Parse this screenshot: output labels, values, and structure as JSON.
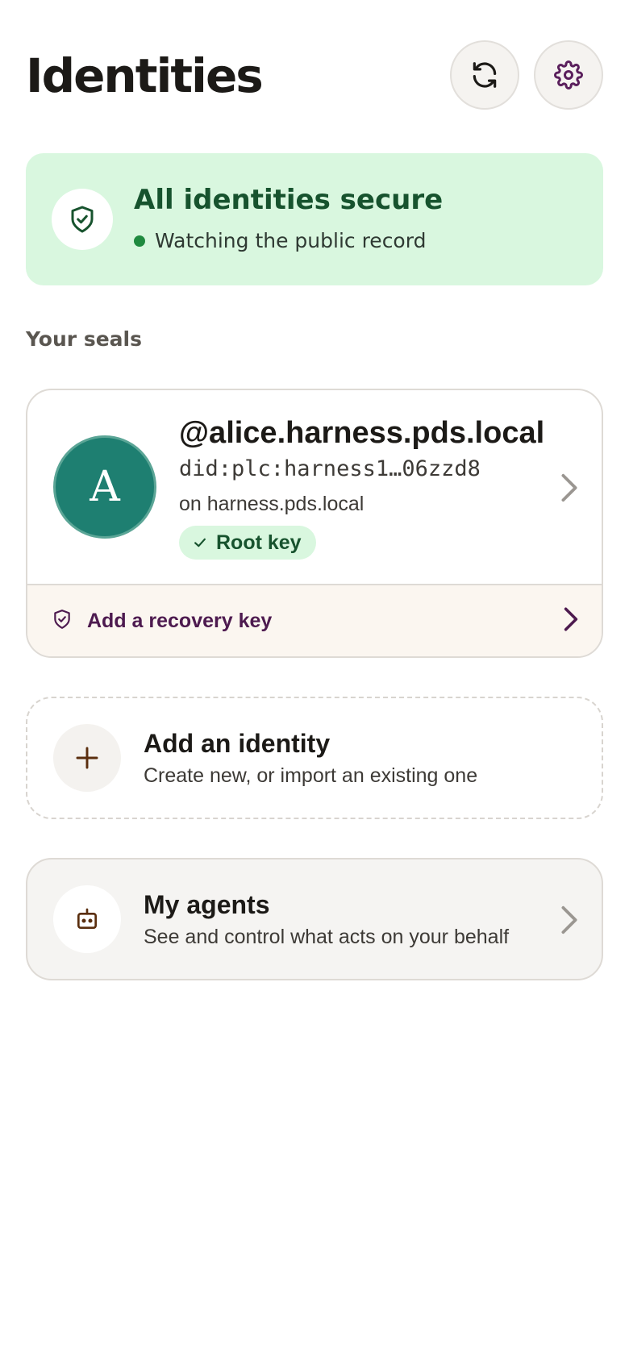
{
  "header": {
    "title": "Identities",
    "refresh_icon": "refresh-icon",
    "settings_icon": "gear-icon"
  },
  "status": {
    "title": "All identities secure",
    "subtitle": "Watching the public record",
    "icon": "shield-check-icon",
    "color": "#17532e",
    "background": "#d9f7df"
  },
  "seals": {
    "label": "Your seals",
    "items": [
      {
        "avatar_letter": "A",
        "avatar_color": "#1e7f71",
        "handle": "@alice.harness.pds.local",
        "did": "did:plc:harness1…06zzd8",
        "host": "on harness.pds.local",
        "badge": "Root key",
        "recovery_label": "Add a recovery key"
      }
    ]
  },
  "add_identity": {
    "title": "Add an identity",
    "subtitle": "Create new, or import an existing one",
    "icon": "plus-icon"
  },
  "agents": {
    "title": "My agents",
    "subtitle": "See and control what acts on your behalf",
    "icon": "robot-icon"
  }
}
